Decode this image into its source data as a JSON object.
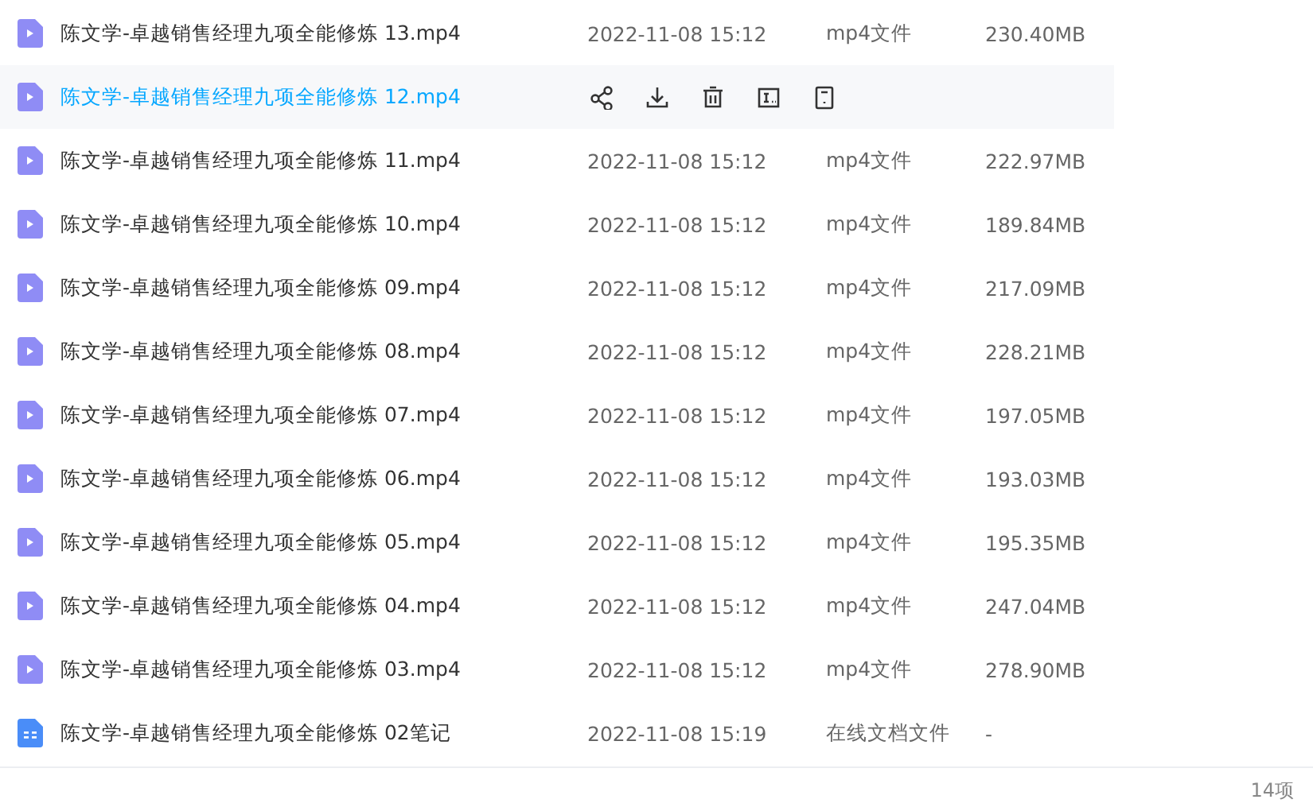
{
  "files": [
    {
      "kind": "video",
      "name": "陈文学-卓越销售经理九项全能修炼 13.mp4",
      "hovered": false,
      "date": "2022-11-08 15:12",
      "type": "mp4文件",
      "size": "230.40MB"
    },
    {
      "kind": "video",
      "name": "陈文学-卓越销售经理九项全能修炼 12.mp4",
      "hovered": true
    },
    {
      "kind": "video",
      "name": "陈文学-卓越销售经理九项全能修炼 11.mp4",
      "hovered": false,
      "date": "2022-11-08 15:12",
      "type": "mp4文件",
      "size": "222.97MB"
    },
    {
      "kind": "video",
      "name": "陈文学-卓越销售经理九项全能修炼 10.mp4",
      "hovered": false,
      "date": "2022-11-08 15:12",
      "type": "mp4文件",
      "size": "189.84MB"
    },
    {
      "kind": "video",
      "name": "陈文学-卓越销售经理九项全能修炼 09.mp4",
      "hovered": false,
      "date": "2022-11-08 15:12",
      "type": "mp4文件",
      "size": "217.09MB"
    },
    {
      "kind": "video",
      "name": "陈文学-卓越销售经理九项全能修炼 08.mp4",
      "hovered": false,
      "date": "2022-11-08 15:12",
      "type": "mp4文件",
      "size": "228.21MB"
    },
    {
      "kind": "video",
      "name": "陈文学-卓越销售经理九项全能修炼 07.mp4",
      "hovered": false,
      "date": "2022-11-08 15:12",
      "type": "mp4文件",
      "size": "197.05MB"
    },
    {
      "kind": "video",
      "name": "陈文学-卓越销售经理九项全能修炼 06.mp4",
      "hovered": false,
      "date": "2022-11-08 15:12",
      "type": "mp4文件",
      "size": "193.03MB"
    },
    {
      "kind": "video",
      "name": "陈文学-卓越销售经理九项全能修炼 05.mp4",
      "hovered": false,
      "date": "2022-11-08 15:12",
      "type": "mp4文件",
      "size": "195.35MB"
    },
    {
      "kind": "video",
      "name": "陈文学-卓越销售经理九项全能修炼 04.mp4",
      "hovered": false,
      "date": "2022-11-08 15:12",
      "type": "mp4文件",
      "size": "247.04MB"
    },
    {
      "kind": "video",
      "name": "陈文学-卓越销售经理九项全能修炼 03.mp4",
      "hovered": false,
      "date": "2022-11-08 15:12",
      "type": "mp4文件",
      "size": "278.90MB"
    },
    {
      "kind": "note",
      "name": "陈文学-卓越销售经理九项全能修炼 02笔记",
      "hovered": false,
      "date": "2022-11-08 15:19",
      "type": "在线文档文件",
      "size": "-"
    }
  ],
  "footer": {
    "count": "14项"
  }
}
